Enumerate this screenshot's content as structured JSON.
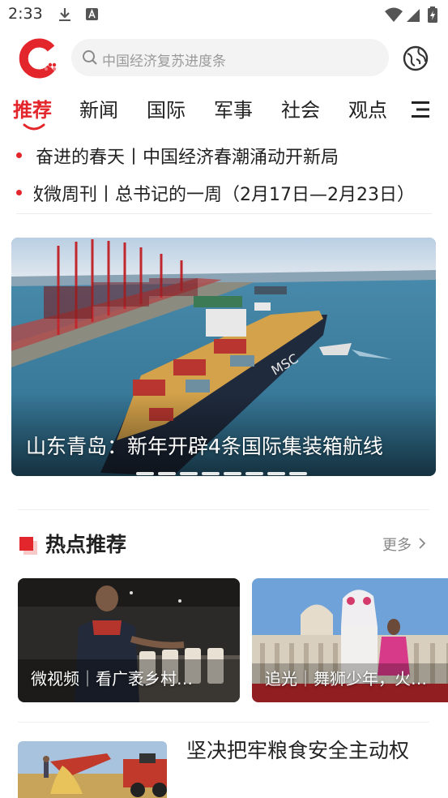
{
  "status_bar": {
    "time": "2:33",
    "icons": [
      "download-icon",
      "font-a-icon",
      "wifi-icon",
      "signal-icon",
      "battery-charging-icon"
    ]
  },
  "header": {
    "logo": "cctv-news-logo",
    "search_placeholder": "中国经济复苏进度条",
    "globe": "globe-icon"
  },
  "tabs": {
    "items": [
      "推荐",
      "新闻",
      "国际",
      "军事",
      "社会",
      "观点"
    ],
    "active": "推荐",
    "menu": "menu-icon"
  },
  "headlines": [
    "奋进的春天丨中国经济春潮涌动开新局",
    "政微周刊丨总书记的一周（2月17日—2月23日）"
  ],
  "banner": {
    "title": "山东青岛：新年开辟4条国际集装箱航线",
    "dot_count": 8,
    "active_index": 0
  },
  "hot": {
    "title": "热点推荐",
    "more_label": "更多",
    "cards": [
      {
        "caption": "微视频｜看广袤乡村…"
      },
      {
        "caption": "追光｜舞狮少年，火…"
      }
    ]
  },
  "news": [
    {
      "title": "坚决把牢粮食安全主动权"
    }
  ],
  "colors": {
    "accent": "#e3262c",
    "text": "#222222",
    "muted": "#888888"
  }
}
